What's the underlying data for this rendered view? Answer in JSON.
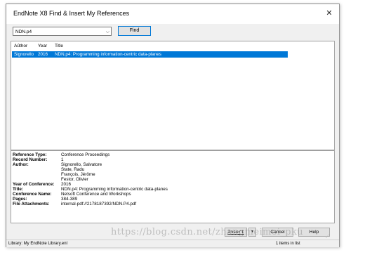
{
  "window": {
    "title": "EndNote X8 Find & Insert My References",
    "close_glyph": "✕"
  },
  "search": {
    "value": "NDN.p4",
    "dropdown_glyph": "⌵",
    "find_label": "Find"
  },
  "results": {
    "sort_glyph": "^",
    "columns": [
      "Author",
      "Year",
      "Title"
    ],
    "rows": [
      {
        "author": "Signorello",
        "year": "2016",
        "title": "NDN.p4: Programming information-centric data-planes",
        "selected": true
      }
    ]
  },
  "details": {
    "reference_type": {
      "label": "Reference Type:",
      "value": "Conference Proceedings"
    },
    "record_number": {
      "label": "Record Number:",
      "value": "1"
    },
    "author": {
      "label": "Author:",
      "values": [
        "Signorello, Salvatore",
        "State, Radu",
        "François, Jérôme",
        "Festor, Olivier"
      ]
    },
    "year": {
      "label": "Year of Conference:",
      "value": "2016"
    },
    "title": {
      "label": "Title:",
      "value": "NDN.p4: Programming information-centric data-planes"
    },
    "conference_name": {
      "label": "Conference Name:",
      "value": "Netsoft Conference and Workshops"
    },
    "pages": {
      "label": "Pages:",
      "value": "384-389"
    },
    "file_attachments": {
      "label": "File Attachments:",
      "value": "internal-pdf://2178187392/NDN.P4.pdf"
    }
  },
  "buttons": {
    "insert": "Insert",
    "insert_dropdown": "▼",
    "cancel": "Cancel",
    "help": "Help"
  },
  "status": {
    "library": "Library: My EndNote Library.enl",
    "count": "1 items in list"
  },
  "watermark": "https://blog.csdn.net/zhangmeimei_pku",
  "colors": {
    "selection": "#0078d7",
    "dialog_bg": "#f0f0f0"
  }
}
